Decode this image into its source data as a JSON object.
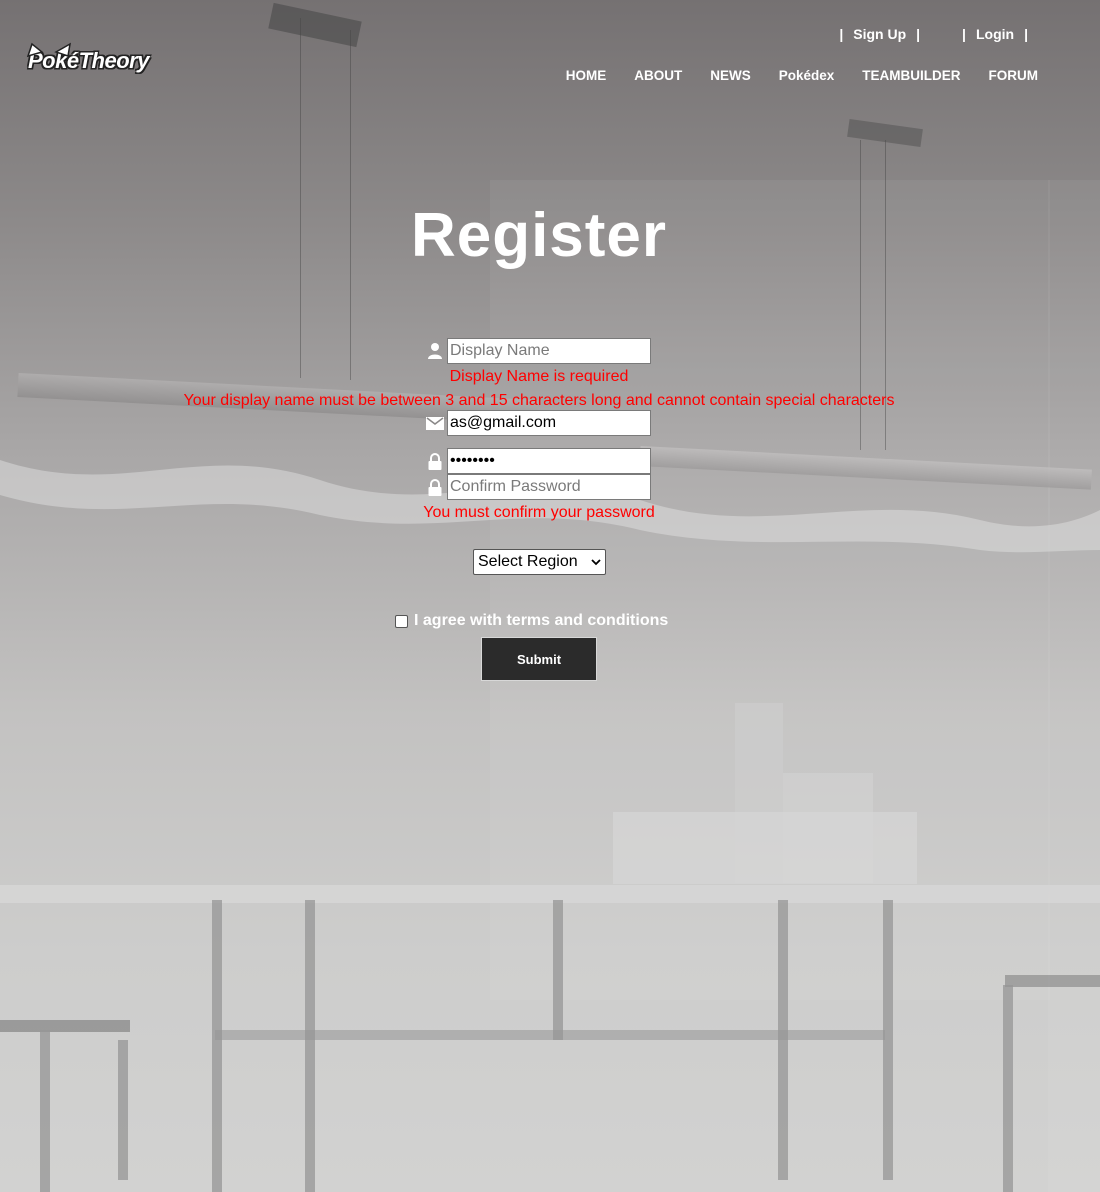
{
  "brand": {
    "logo_text": "PokéTheory"
  },
  "account_nav": {
    "sign_up": "Sign Up",
    "login": "Login",
    "separator": "|"
  },
  "main_nav": {
    "items": [
      {
        "label": "HOME"
      },
      {
        "label": "ABOUT"
      },
      {
        "label": "NEWS"
      },
      {
        "label": "Pokédex"
      },
      {
        "label": "TEAMBUILDER"
      },
      {
        "label": "FORUM"
      }
    ]
  },
  "form": {
    "title": "Register",
    "display_name": {
      "icon": "user-icon",
      "placeholder": "Display Name",
      "value": "",
      "errors": [
        "Display Name is required",
        "Your display name must be between 3 and 15 characters long and cannot contain special characters"
      ]
    },
    "email": {
      "icon": "envelope-icon",
      "value": "as@gmail.com"
    },
    "password": {
      "icon": "lock-icon",
      "value": "••••••••"
    },
    "confirm_password": {
      "icon": "lock-icon",
      "placeholder": "Confirm Password",
      "value": "",
      "error": "You must confirm your password"
    },
    "region": {
      "selected": "Select Region"
    },
    "terms": {
      "label": "I agree with terms and conditions",
      "checked": false
    },
    "submit_label": "Submit"
  },
  "colors": {
    "error": "#ff0000",
    "button_bg": "#2b2b2b",
    "text": "#ffffff"
  }
}
